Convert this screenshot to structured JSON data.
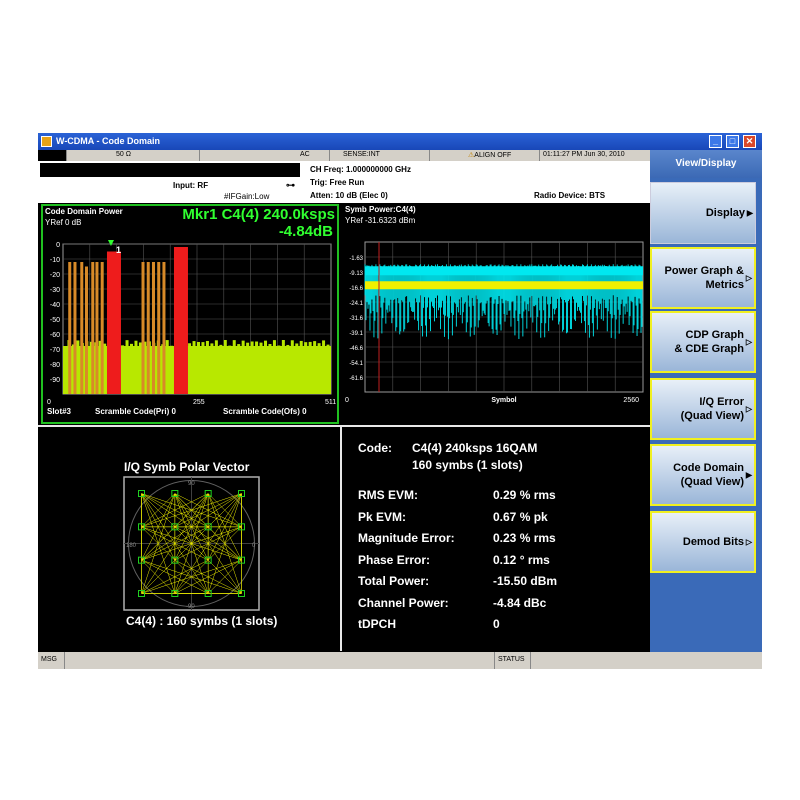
{
  "window": {
    "title": "W-CDMA - Code Domain",
    "min_icon": "minimize-icon",
    "max_icon": "maximize-icon",
    "close_icon": "close-icon"
  },
  "status_row": {
    "impedance": "50 Ω",
    "coupling": "AC",
    "sense": "SENSE:INT",
    "align": "ALIGN OFF",
    "datetime": "01:11:27 PM Jun 30, 2010"
  },
  "info": {
    "input": "Input: RF",
    "if_gain": "#IFGain:Low",
    "ch_freq": "CH Freq: 1.000000000 GHz",
    "trig": "Trig: Free Run",
    "atten": "Atten: 10 dB (Elec 0)",
    "radio_device": "Radio Device: BTS"
  },
  "cdp": {
    "title": "Code Domain Power",
    "yref": "YRef 0 dB",
    "marker_line1": "Mkr1 C4(4) 240.0ksps",
    "marker_line2": "-4.84dB",
    "marker_label": "1",
    "y_ticks": [
      "0",
      "-10",
      "-20",
      "-30",
      "-40",
      "-50",
      "-60",
      "-70",
      "-80",
      "-90"
    ],
    "x_ticks": [
      "0",
      "255",
      "511"
    ],
    "slot": "Slot#3",
    "scramble_pri": "Scramble Code(Pri) 0",
    "scramble_ofs": "Scramble Code(Ofs) 0",
    "colors": {
      "active": "#d88a28",
      "selected": "#ee1c1c",
      "noise": "#b8e800",
      "grid": "#9a9a9a"
    }
  },
  "symb": {
    "title": "Symb Power:C4(4)",
    "yref": "YRef  -31.6323 dBm",
    "y_ticks": [
      "-1.63",
      "-9.13",
      "-16.6",
      "-24.1",
      "-31.6",
      "-39.1",
      "-46.6",
      "-54.1",
      "-61.6"
    ],
    "x_ticks": [
      "0",
      "Symbol",
      "2560"
    ],
    "colors": {
      "trace": "#00e8f0",
      "band": "#f0f000",
      "marker": "#c02020"
    }
  },
  "iq": {
    "title": "I/Q Symb Polar Vector",
    "caption": "C4(4) : 160 symbs (1 slots)",
    "axis_labels": {
      "top": "90",
      "left": "180",
      "right": "0",
      "bottom": "-90"
    },
    "colors": {
      "vector": "#e8e800",
      "point": "#20d020"
    }
  },
  "metrics": {
    "code_label": "Code:",
    "code_value": "C4(4) 240ksps 16QAM",
    "code_sub": "160 symbs (1 slots)",
    "rows": [
      {
        "k": "RMS EVM:",
        "v": "0.29 % rms"
      },
      {
        "k": "Pk EVM:",
        "v": "0.67 % pk"
      },
      {
        "k": "Magnitude Error:",
        "v": "0.23 % rms"
      },
      {
        "k": "Phase Error:",
        "v": "0.12 ° rms"
      },
      {
        "k": "Total Power:",
        "v": "-15.50 dBm"
      },
      {
        "k": "Channel Power:",
        "v": "-4.84 dBc"
      },
      {
        "k": "tDPCH",
        "v": "0"
      }
    ]
  },
  "sidebar": {
    "header": "View/Display",
    "keys": [
      {
        "l1": "Display",
        "l2": "",
        "arrow": "▶"
      },
      {
        "l1": "Power Graph &",
        "l2": "Metrics",
        "arrow": "▷"
      },
      {
        "l1": "CDP Graph",
        "l2": "& CDE Graph",
        "arrow": "▷"
      },
      {
        "l1": "I/Q Error",
        "l2": "(Quad View)",
        "arrow": "▷"
      },
      {
        "l1": "Code Domain",
        "l2": "(Quad View)",
        "arrow": "▶"
      },
      {
        "l1": "Demod Bits",
        "l2": "",
        "arrow": "▷"
      }
    ]
  },
  "msgbar": {
    "msg": "MSG",
    "status": "STATUS"
  }
}
